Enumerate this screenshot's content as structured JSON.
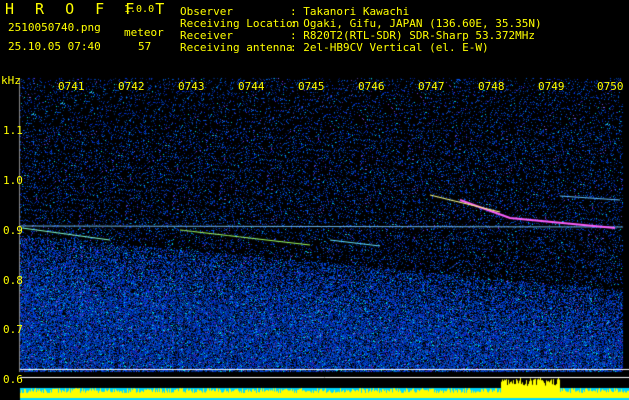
{
  "header": {
    "app_name": "H R O F F T",
    "version": "1.0.0",
    "filename": "2510050740.png",
    "datetime": "25.10.05 07:40",
    "meteor_label": "meteor",
    "meteor_count": "57",
    "info_labels": [
      "Observer",
      "Receiving Location",
      "Receiver",
      "Receiving antenna"
    ],
    "info_values": [
      ": Takanori Kawachi",
      ": Ogaki, Gifu, JAPAN (136.60E, 35.35N)",
      ": R820T2(RTL-SDR) SDR-Sharp 53.372MHz",
      ": 2el-HB9CV Vertical (el. E-W)"
    ]
  },
  "axis": {
    "unit": "kHz",
    "y_ticks": [
      "1.1",
      "1.0",
      "0.9",
      "0.8",
      "0.7",
      "0.6"
    ],
    "x_ticks": [
      "0741",
      "0742",
      "0743",
      "0744",
      "0745",
      "0746",
      "0747",
      "0748",
      "0749",
      "0750"
    ]
  },
  "colors": {
    "text": "#ffff00",
    "background": "#000000",
    "noise": "#1030c0",
    "band_bottom": "#00e0ff",
    "meteor_line": "#ff60ff"
  }
}
